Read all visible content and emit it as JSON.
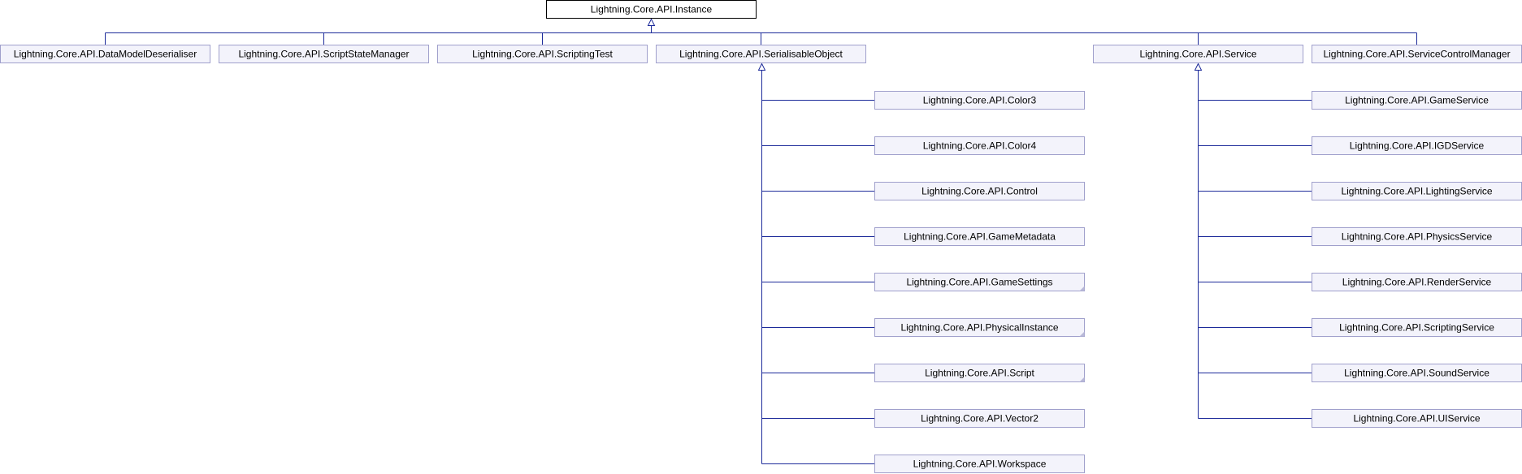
{
  "diagram": {
    "root": "Lightning.Core.API.Instance",
    "children": [
      "Lightning.Core.API.DataModelDeserialiser",
      "Lightning.Core.API.ScriptStateManager",
      "Lightning.Core.API.ScriptingTest",
      "Lightning.Core.API.SerialisableObject",
      "Lightning.Core.API.Service",
      "Lightning.Core.API.ServiceControlManager"
    ],
    "serialisable_children": [
      "Lightning.Core.API.Color3",
      "Lightning.Core.API.Color4",
      "Lightning.Core.API.Control",
      "Lightning.Core.API.GameMetadata",
      "Lightning.Core.API.GameSettings",
      "Lightning.Core.API.PhysicalInstance",
      "Lightning.Core.API.Script",
      "Lightning.Core.API.Vector2",
      "Lightning.Core.API.Workspace"
    ],
    "service_children": [
      "Lightning.Core.API.GameService",
      "Lightning.Core.API.IGDService",
      "Lightning.Core.API.LightingService",
      "Lightning.Core.API.PhysicsService",
      "Lightning.Core.API.RenderService",
      "Lightning.Core.API.ScriptingService",
      "Lightning.Core.API.SoundService",
      "Lightning.Core.API.UIService"
    ],
    "has_more_subclasses": [
      "Lightning.Core.API.GameSettings",
      "Lightning.Core.API.PhysicalInstance",
      "Lightning.Core.API.Script"
    ]
  }
}
